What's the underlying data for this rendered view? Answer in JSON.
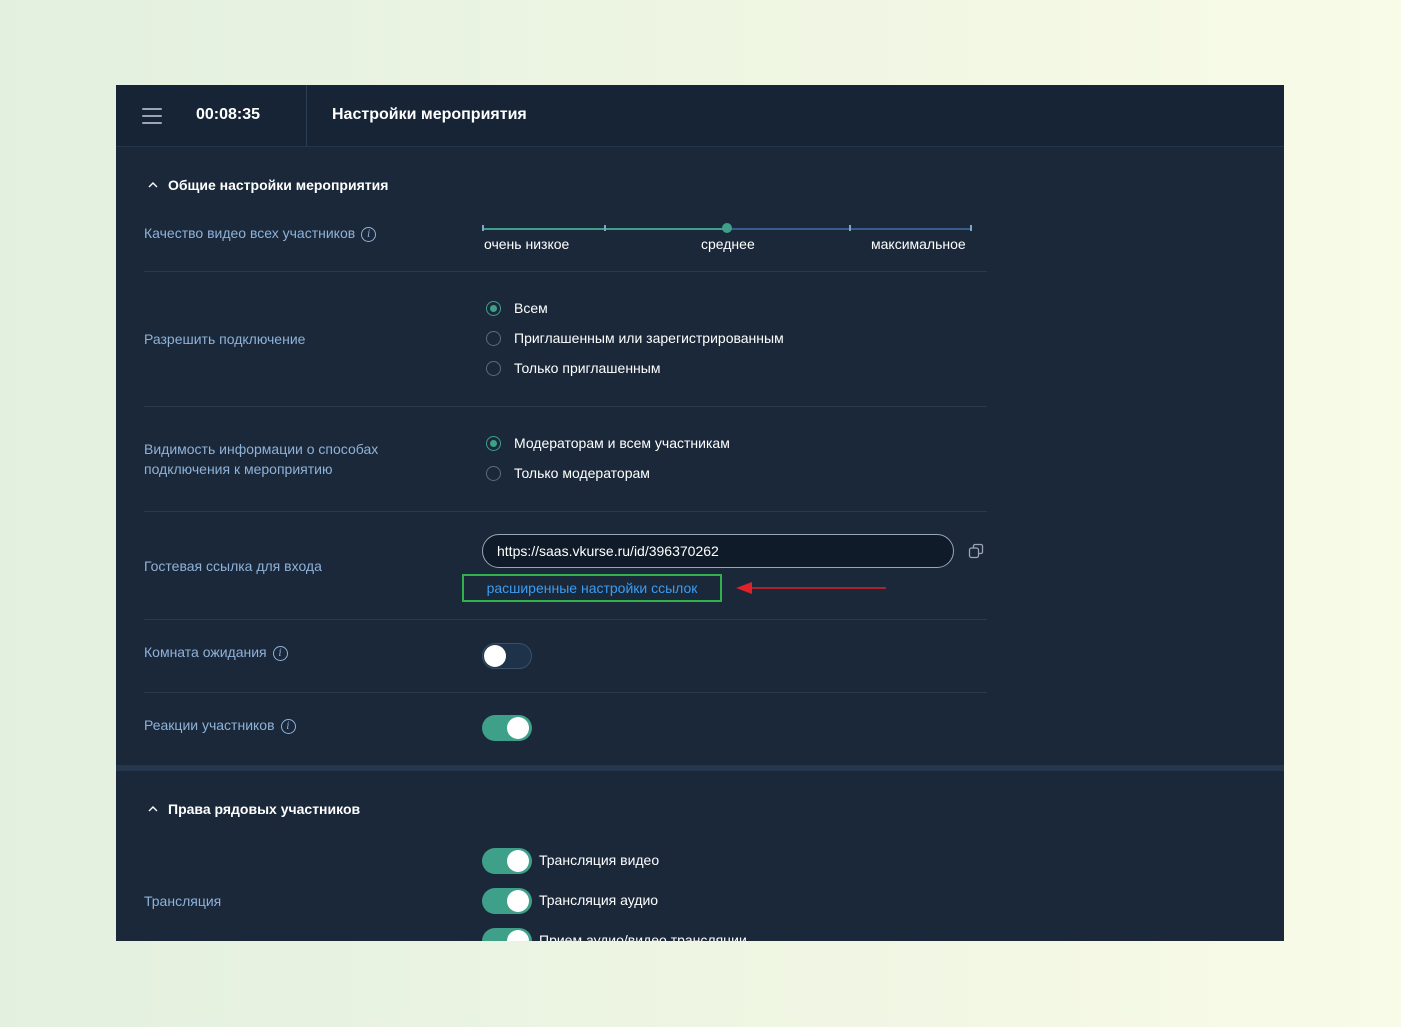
{
  "topbar": {
    "timer": "00:08:35",
    "title": "Настройки мероприятия"
  },
  "general": {
    "title": "Общие настройки мероприятия",
    "video_quality": {
      "label": "Качество видео всех участников",
      "options": [
        "очень низкое",
        "среднее",
        "максимальное"
      ],
      "selected": "среднее",
      "level_fraction": 0.5
    },
    "allow_connection": {
      "label": "Разрешить подключение",
      "options": [
        "Всем",
        "Приглашенным или зарегистрированным",
        "Только приглашенным"
      ],
      "selected": "Всем"
    },
    "visibility": {
      "label": "Видимость информации о способах подключения к мероприятию",
      "options": [
        "Модераторам и всем участникам",
        "Только модераторам"
      ],
      "selected": "Модераторам и всем участникам"
    },
    "guest_link": {
      "label": "Гостевая ссылка для входа",
      "value": "https://saas.vkurse.ru/id/396370262",
      "advanced_link": "расширенные настройки ссылок"
    },
    "waiting_room": {
      "label": "Комната ожидания",
      "enabled": false
    },
    "reactions": {
      "label": "Реакции участников",
      "enabled": true
    }
  },
  "rights": {
    "title": "Права рядовых участников",
    "broadcast": {
      "label": "Трансляция",
      "items": [
        {
          "label": "Трансляция видео",
          "enabled": true
        },
        {
          "label": "Трансляция аудио",
          "enabled": true
        },
        {
          "label": "Прием аудио/видео трансляции",
          "enabled": true
        }
      ]
    }
  },
  "colors": {
    "panel_bg": "#1a283a",
    "accent_green": "#3fa08a",
    "label_blue": "#8fb2d8",
    "link_blue": "#3b9cf2",
    "highlight_box": "#2fb24a",
    "annotation_arrow": "#e0202a"
  },
  "icons": [
    "hamburger-menu-icon",
    "chevron-up-icon",
    "info-icon",
    "copy-icon",
    "annotation-arrow-icon"
  ]
}
